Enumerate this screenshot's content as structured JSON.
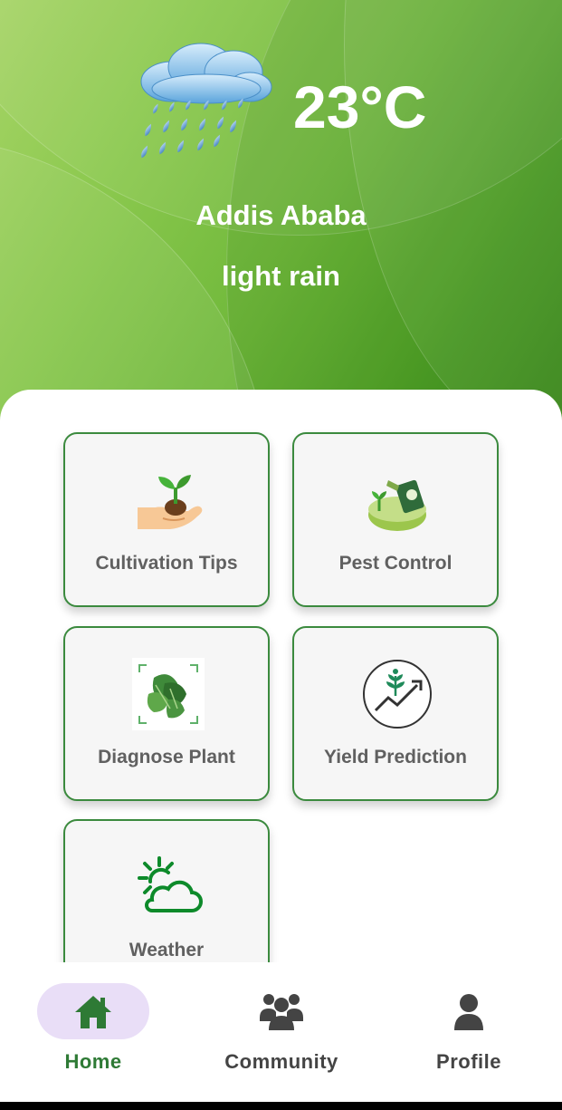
{
  "weather": {
    "temperature": "23°C",
    "city": "Addis Ababa",
    "condition": "light rain",
    "icon": "rain-cloud-icon"
  },
  "features": [
    {
      "label": "Cultivation Tips",
      "icon": "seedling-hand-icon"
    },
    {
      "label": "Pest Control",
      "icon": "pest-spray-icon"
    },
    {
      "label": "Diagnose Plant",
      "icon": "leaf-scan-icon"
    },
    {
      "label": "Yield Prediction",
      "icon": "yield-growth-icon"
    },
    {
      "label": "Weather",
      "icon": "sun-cloud-icon"
    }
  ],
  "nav": {
    "items": [
      {
        "label": "Home",
        "icon": "home-icon",
        "active": true
      },
      {
        "label": "Community",
        "icon": "community-icon",
        "active": false
      },
      {
        "label": "Profile",
        "icon": "person-icon",
        "active": false
      }
    ]
  },
  "colors": {
    "accent": "#2e7a35",
    "card_border": "#3b8a3e",
    "active_pill": "#e9def7"
  }
}
